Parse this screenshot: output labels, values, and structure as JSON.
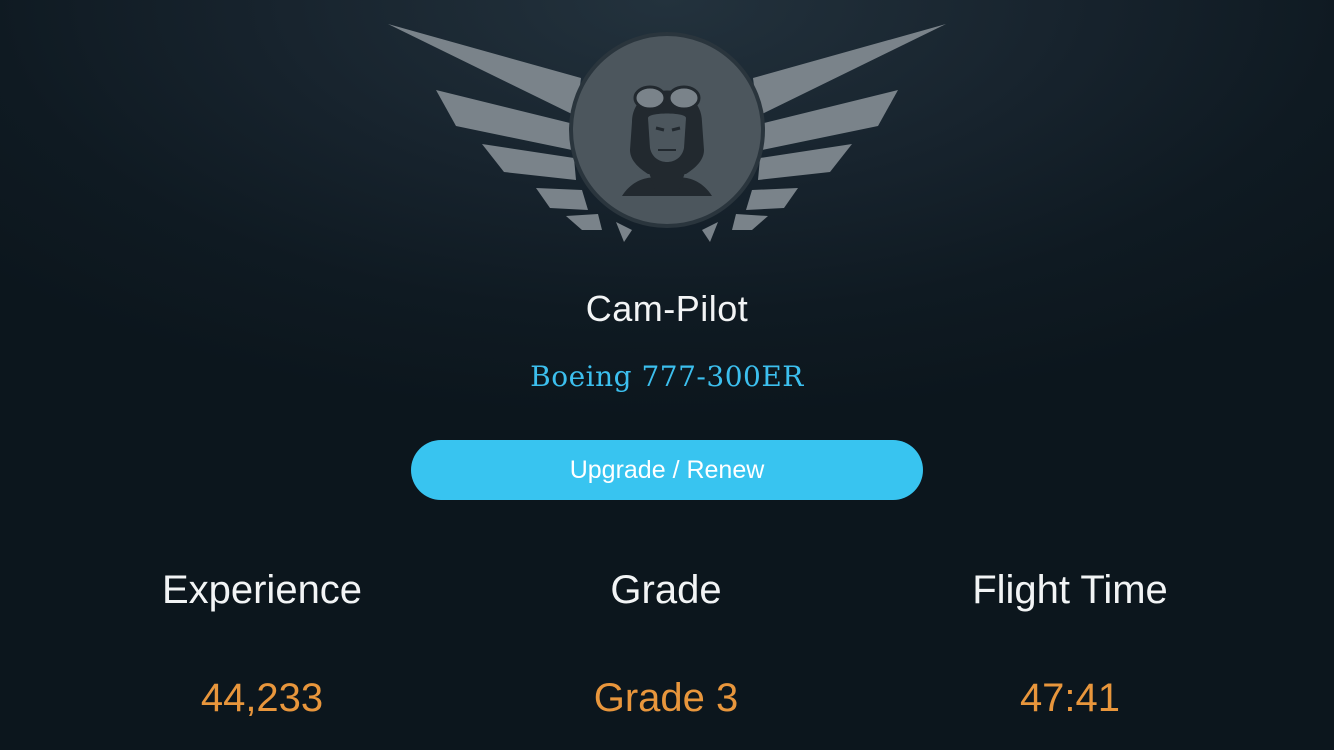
{
  "profile": {
    "name": "Cam-Pilot",
    "aircraft": "Boeing 777-300ER"
  },
  "actions": {
    "upgrade_label": "Upgrade / Renew"
  },
  "stats": [
    {
      "label": "Experience",
      "value": "44,233"
    },
    {
      "label": "Grade",
      "value": "Grade 3"
    },
    {
      "label": "Flight Time",
      "value": "47:41"
    }
  ],
  "badge": {
    "icon": "pilot-wings-badge-icon"
  },
  "colors": {
    "accent": "#38c4f0",
    "value": "#e8963c",
    "background": "#0f1a22",
    "badge": "#7d868c"
  }
}
